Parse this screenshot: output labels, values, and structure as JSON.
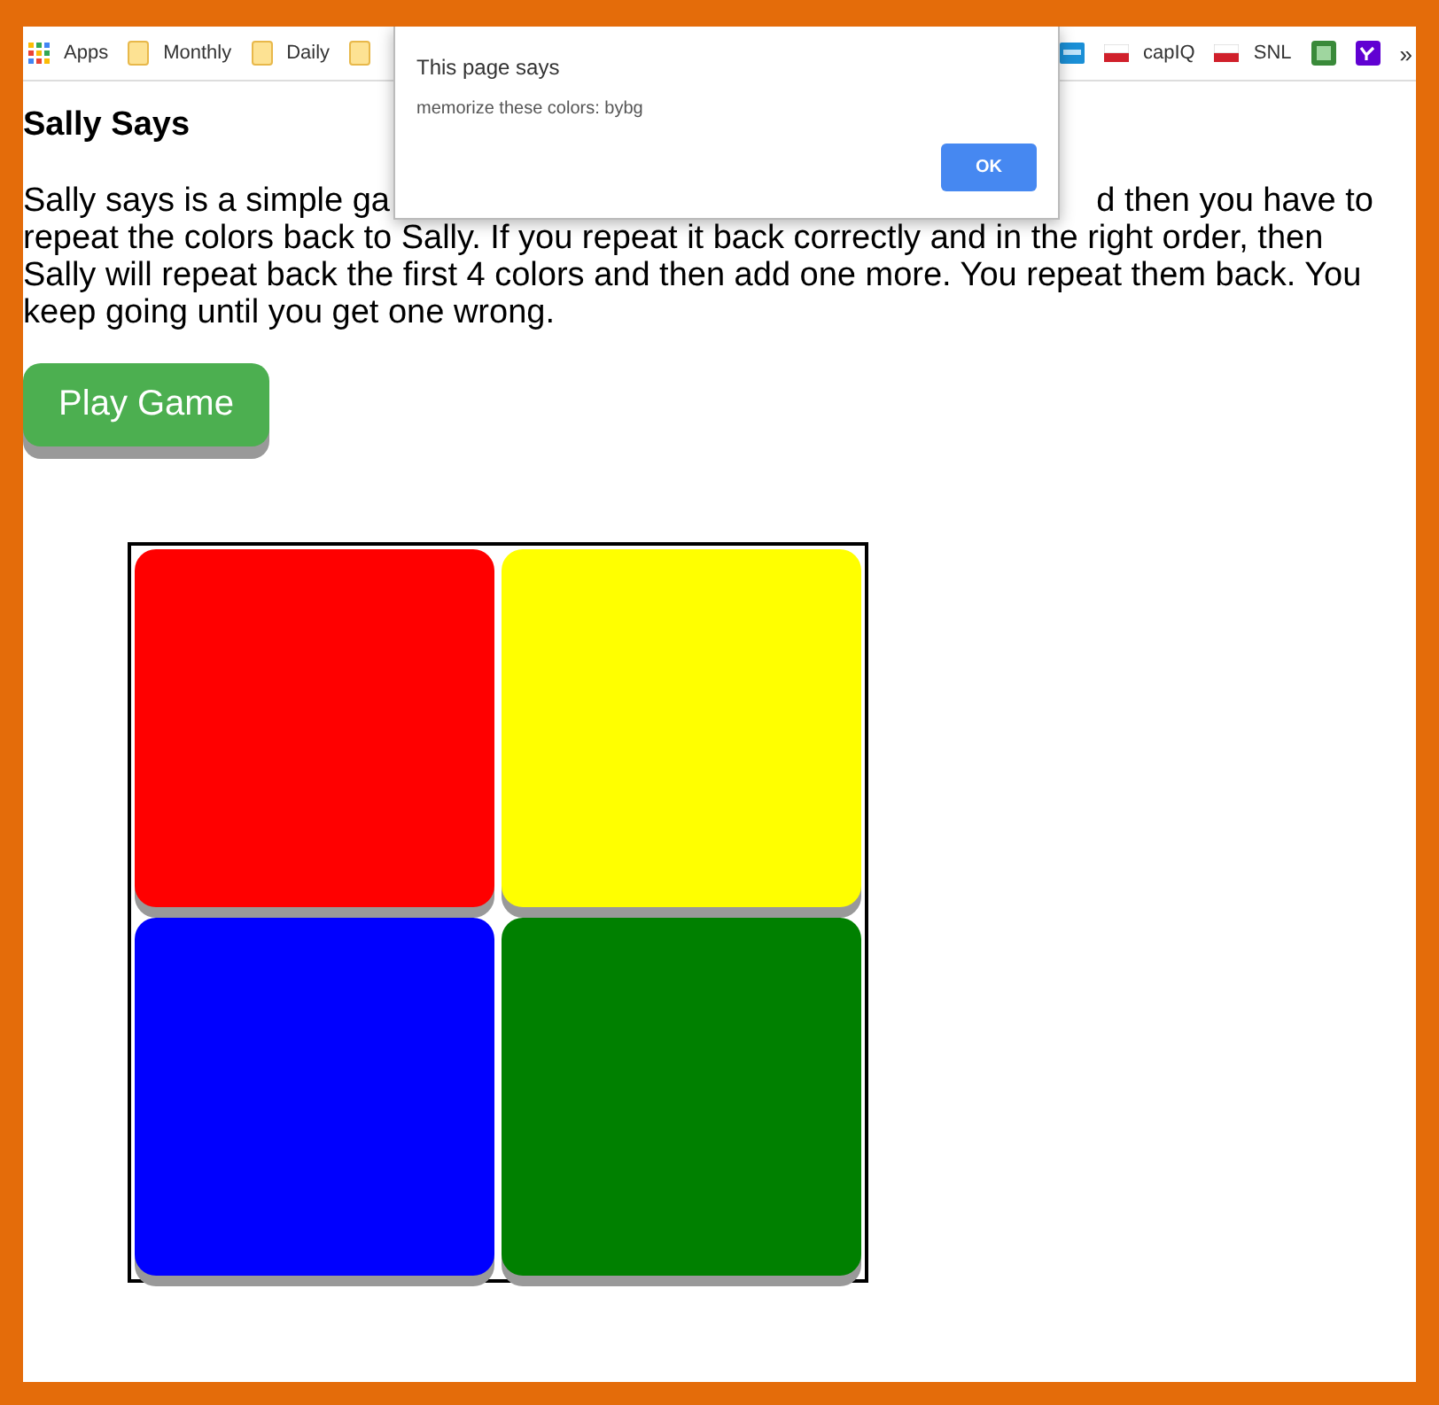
{
  "bookmarks": [
    {
      "kind": "apps",
      "label": "Apps"
    },
    {
      "kind": "folder",
      "label": "Monthly"
    },
    {
      "kind": "folder",
      "label": "Daily"
    },
    {
      "kind": "folder"
    },
    {
      "kind": "spacer"
    },
    {
      "kind": "bluecard"
    },
    {
      "kind": "flag",
      "label": "capIQ"
    },
    {
      "kind": "flag",
      "label": "SNL"
    },
    {
      "kind": "greenapp"
    },
    {
      "kind": "yahoo"
    },
    {
      "kind": "more",
      "label": "»"
    }
  ],
  "title": "Sally Says",
  "intro_line_start": "Sally says is a simple ga",
  "intro_line_end": "d then you have to",
  "intro_rest": "repeat the colors back to Sally. If you repeat it back correctly and in the right order, then Sally will repeat back the first 4 colors and then add one more. You repeat them back. You keep going until you get one wrong.",
  "play_button": "Play Game",
  "tiles": [
    {
      "color": "#ff0000"
    },
    {
      "color": "#ffff00"
    },
    {
      "color": "#0000ff"
    },
    {
      "color": "#008000"
    }
  ],
  "dialog": {
    "title": "This page says",
    "message": "memorize these colors: bybg",
    "button": "OK"
  }
}
